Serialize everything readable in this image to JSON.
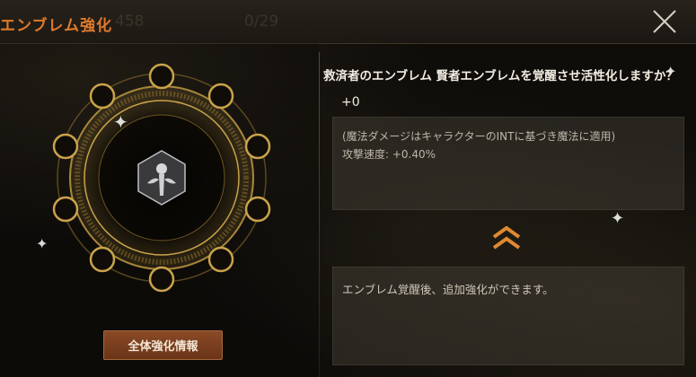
{
  "header": {
    "title": "エンブレム強化",
    "ghost_value_1": "458",
    "ghost_value_2": "0/29",
    "close_icon": "close-x-icon"
  },
  "left": {
    "emblem_icon": "sage-emblem-icon",
    "ring_slots": 10,
    "all_info_button": "全体強化情報"
  },
  "right": {
    "question": "救済者のエンブレム 賢者エンブレムを覚醒させ活性化しますか？",
    "level": "+0",
    "effects": [
      "(魔法ダメージはキャラクターのINTに基づき魔法に適用)",
      "攻撃速度: +0.40%"
    ],
    "upgrade_icon": "double-chevron-up-icon",
    "info": "エンブレム覚醒後、追加強化ができます。"
  },
  "colors": {
    "accent": "#e07a2a",
    "gold": "#c9a24a",
    "button": "#7a3f20"
  }
}
